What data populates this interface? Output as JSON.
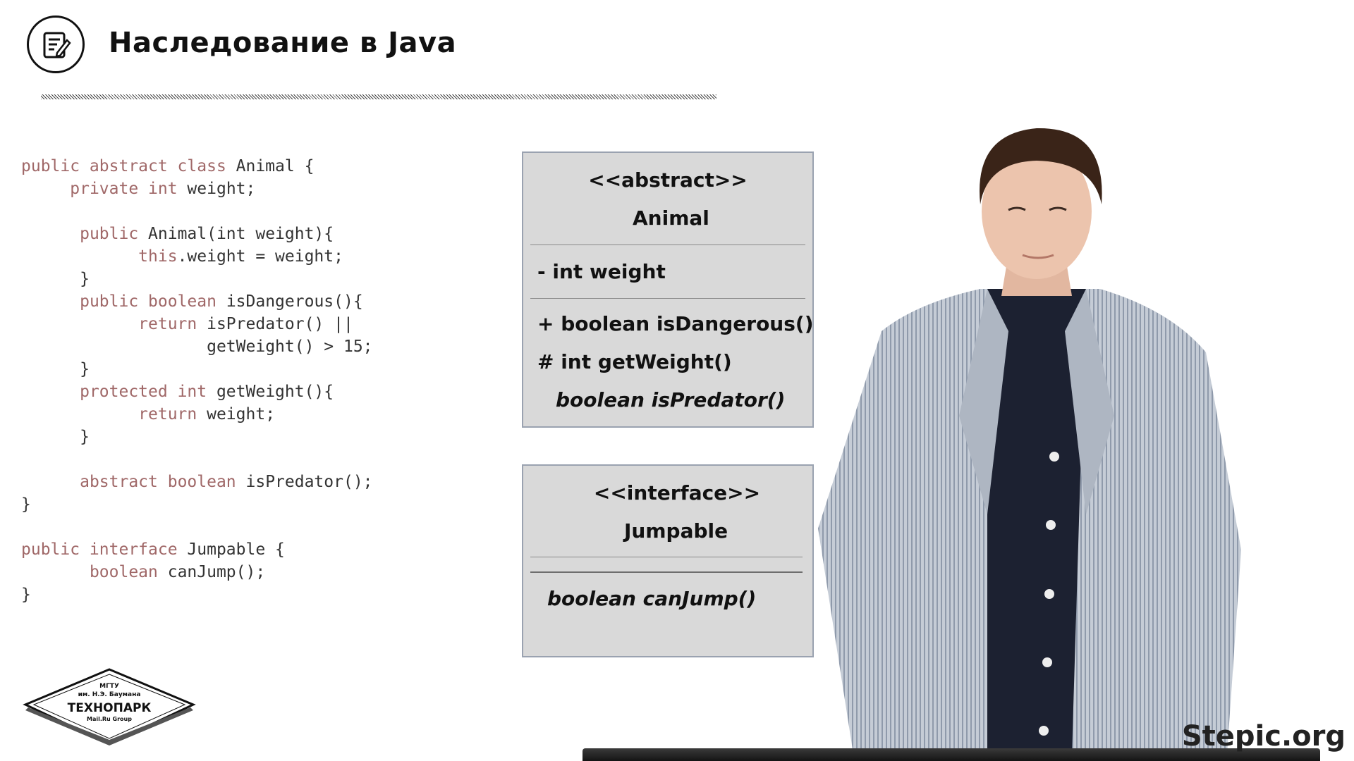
{
  "header": {
    "title": "Наследование в Java",
    "icon": "document-edit-icon"
  },
  "code": {
    "lines": [
      {
        "indent": "",
        "tokens": [
          {
            "t": "public abstract class",
            "kw": true
          },
          {
            "t": " Animal {",
            "kw": false
          }
        ]
      },
      {
        "indent": "     ",
        "tokens": [
          {
            "t": "private int",
            "kw": true
          },
          {
            "t": " weight;",
            "kw": false
          }
        ]
      },
      {
        "indent": "",
        "tokens": []
      },
      {
        "indent": "      ",
        "tokens": [
          {
            "t": "public",
            "kw": true
          },
          {
            "t": " Animal(int weight){",
            "kw": false
          }
        ]
      },
      {
        "indent": "            ",
        "tokens": [
          {
            "t": "this",
            "kw": true
          },
          {
            "t": ".weight = weight;",
            "kw": false
          }
        ]
      },
      {
        "indent": "      ",
        "tokens": [
          {
            "t": "}",
            "kw": false
          }
        ]
      },
      {
        "indent": "      ",
        "tokens": [
          {
            "t": "public boolean",
            "kw": true
          },
          {
            "t": " isDangerous(){",
            "kw": false
          }
        ]
      },
      {
        "indent": "            ",
        "tokens": [
          {
            "t": "return",
            "kw": true
          },
          {
            "t": " isPredator() ||",
            "kw": false
          }
        ]
      },
      {
        "indent": "                   ",
        "tokens": [
          {
            "t": "getWeight() > 15;",
            "kw": false
          }
        ]
      },
      {
        "indent": "      ",
        "tokens": [
          {
            "t": "}",
            "kw": false
          }
        ]
      },
      {
        "indent": "      ",
        "tokens": [
          {
            "t": "protected int",
            "kw": true
          },
          {
            "t": " getWeight(){",
            "kw": false
          }
        ]
      },
      {
        "indent": "            ",
        "tokens": [
          {
            "t": "return",
            "kw": true
          },
          {
            "t": " weight;",
            "kw": false
          }
        ]
      },
      {
        "indent": "      ",
        "tokens": [
          {
            "t": "}",
            "kw": false
          }
        ]
      },
      {
        "indent": "",
        "tokens": []
      },
      {
        "indent": "      ",
        "tokens": [
          {
            "t": "abstract boolean",
            "kw": true
          },
          {
            "t": " isPredator();",
            "kw": false
          }
        ]
      },
      {
        "indent": "",
        "tokens": [
          {
            "t": "}",
            "kw": false
          }
        ]
      },
      {
        "indent": "",
        "tokens": []
      },
      {
        "indent": "",
        "tokens": [
          {
            "t": "public interface",
            "kw": true
          },
          {
            "t": " Jumpable {",
            "kw": false
          }
        ]
      },
      {
        "indent": "       ",
        "tokens": [
          {
            "t": "boolean",
            "kw": true
          },
          {
            "t": " canJump();",
            "kw": false
          }
        ]
      },
      {
        "indent": "",
        "tokens": [
          {
            "t": "}",
            "kw": false
          }
        ]
      }
    ]
  },
  "uml_animal": {
    "stereotype": "<<abstract>>",
    "name": "Animal",
    "field": "- int weight",
    "method_1": "+ boolean isDangerous()",
    "method_2": "# int getWeight()",
    "method_3": "boolean isPredator()"
  },
  "uml_jumpable": {
    "stereotype": "<<interface>>",
    "name": "Jumpable",
    "method_1": "boolean canJump()"
  },
  "logo": {
    "line1": "МГТУ",
    "line2": "им. Н.Э. Баумана",
    "name": "ТЕХНОПАРК",
    "sub": "Mail.Ru Group"
  },
  "watermark": "Stepic.org",
  "colors": {
    "keyword": "#a06868",
    "code_text": "#333333",
    "uml_fill": "#d9d9d9",
    "uml_border": "#9aa2b0"
  }
}
